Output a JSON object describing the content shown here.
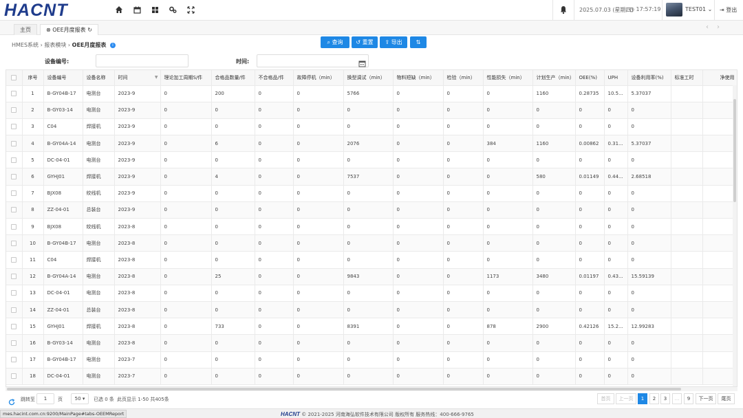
{
  "header": {
    "logo": "HACNT",
    "date": "2025.07.03 (星期四)",
    "time": "17:57:19",
    "user": "TEST01",
    "logout": "登出"
  },
  "tabs": [
    {
      "label": "主页"
    },
    {
      "label": "OEE月度报表"
    }
  ],
  "breadcrumb": {
    "root": "HMES系统",
    "module": "报表模块",
    "current": "OEE月度报表"
  },
  "toolbar": {
    "query": "查询",
    "reset": "重置",
    "export": "导出"
  },
  "filters": {
    "device_label": "设备编号:",
    "device_value": "",
    "time_label": "时间:",
    "time_value": ""
  },
  "table": {
    "columns": [
      "序号",
      "设备编号",
      "设备名称",
      "时间",
      "理论加工周期S/件",
      "合格品数量/件",
      "不合格品/件",
      "故障停机（min）",
      "换型调试（min）",
      "物料短缺（min）",
      "检验（min）",
      "性能损失（min）",
      "计划生产（min）",
      "OEE(%)",
      "UPH",
      "设备利用率(%)",
      "标准工时",
      "净使用"
    ],
    "rows": [
      [
        "1",
        "B-GY04B-17",
        "电测台",
        "2023-9",
        "0",
        "200",
        "0",
        "0",
        "5766",
        "0",
        "0",
        "0",
        "1160",
        "0.28735",
        "10.5...",
        "5.37037",
        "",
        ""
      ],
      [
        "2",
        "B-GY03-14",
        "电测台",
        "2023-9",
        "0",
        "0",
        "0",
        "0",
        "0",
        "0",
        "0",
        "0",
        "0",
        "0",
        "0",
        "0",
        "",
        ""
      ],
      [
        "3",
        "C04",
        "焊接机",
        "2023-9",
        "0",
        "0",
        "0",
        "0",
        "0",
        "0",
        "0",
        "0",
        "0",
        "0",
        "0",
        "0",
        "",
        ""
      ],
      [
        "4",
        "B-GY04A-14",
        "电测台",
        "2023-9",
        "0",
        "6",
        "0",
        "0",
        "2076",
        "0",
        "0",
        "384",
        "1160",
        "0.00862",
        "0.31...",
        "5.37037",
        "",
        ""
      ],
      [
        "5",
        "DC-04-01",
        "电测台",
        "2023-9",
        "0",
        "0",
        "0",
        "0",
        "0",
        "0",
        "0",
        "0",
        "0",
        "0",
        "0",
        "0",
        "",
        ""
      ],
      [
        "6",
        "GYHJ01",
        "焊接机",
        "2023-9",
        "0",
        "4",
        "0",
        "0",
        "7537",
        "0",
        "0",
        "0",
        "580",
        "0.01149",
        "0.44...",
        "2.68518",
        "",
        ""
      ],
      [
        "7",
        "BJX08",
        "绞线机",
        "2023-9",
        "0",
        "0",
        "0",
        "0",
        "0",
        "0",
        "0",
        "0",
        "0",
        "0",
        "0",
        "0",
        "",
        ""
      ],
      [
        "8",
        "ZZ-04-01",
        "总装台",
        "2023-9",
        "0",
        "0",
        "0",
        "0",
        "0",
        "0",
        "0",
        "0",
        "0",
        "0",
        "0",
        "0",
        "",
        ""
      ],
      [
        "9",
        "BJX08",
        "绞线机",
        "2023-8",
        "0",
        "0",
        "0",
        "0",
        "0",
        "0",
        "0",
        "0",
        "0",
        "0",
        "0",
        "0",
        "",
        ""
      ],
      [
        "10",
        "B-GY04B-17",
        "电测台",
        "2023-8",
        "0",
        "0",
        "0",
        "0",
        "0",
        "0",
        "0",
        "0",
        "0",
        "0",
        "0",
        "0",
        "",
        ""
      ],
      [
        "11",
        "C04",
        "焊接机",
        "2023-8",
        "0",
        "0",
        "0",
        "0",
        "0",
        "0",
        "0",
        "0",
        "0",
        "0",
        "0",
        "0",
        "",
        ""
      ],
      [
        "12",
        "B-GY04A-14",
        "电测台",
        "2023-8",
        "0",
        "25",
        "0",
        "0",
        "9843",
        "0",
        "0",
        "1173",
        "3480",
        "0.01197",
        "0.43...",
        "15.59139",
        "",
        ""
      ],
      [
        "13",
        "DC-04-01",
        "电测台",
        "2023-8",
        "0",
        "0",
        "0",
        "0",
        "0",
        "0",
        "0",
        "0",
        "0",
        "0",
        "0",
        "0",
        "",
        ""
      ],
      [
        "14",
        "ZZ-04-01",
        "总装台",
        "2023-8",
        "0",
        "0",
        "0",
        "0",
        "0",
        "0",
        "0",
        "0",
        "0",
        "0",
        "0",
        "0",
        "",
        ""
      ],
      [
        "15",
        "GYHJ01",
        "焊接机",
        "2023-8",
        "0",
        "733",
        "0",
        "0",
        "8391",
        "0",
        "0",
        "878",
        "2900",
        "0.42126",
        "15.2...",
        "12.99283",
        "",
        ""
      ],
      [
        "16",
        "B-GY03-14",
        "电测台",
        "2023-8",
        "0",
        "0",
        "0",
        "0",
        "0",
        "0",
        "0",
        "0",
        "0",
        "0",
        "0",
        "0",
        "",
        ""
      ],
      [
        "17",
        "B-GY04B-17",
        "电测台",
        "2023-7",
        "0",
        "0",
        "0",
        "0",
        "0",
        "0",
        "0",
        "0",
        "0",
        "0",
        "0",
        "0",
        "",
        ""
      ],
      [
        "18",
        "DC-04-01",
        "电测台",
        "2023-7",
        "0",
        "0",
        "0",
        "0",
        "0",
        "0",
        "0",
        "0",
        "0",
        "0",
        "0",
        "0",
        "",
        ""
      ]
    ]
  },
  "pager": {
    "goto_label": "跳转至",
    "goto_value": "1",
    "page_unit": "页",
    "page_size": "50",
    "selected": "已选 0 条",
    "summary": "此页显示 1-50 共405条",
    "first": "首页",
    "prev": "上一页",
    "pages": [
      "1",
      "2",
      "3",
      "...",
      "9"
    ],
    "next": "下一页",
    "last": "尾页"
  },
  "footer": {
    "url": "mes.hacint.com.cn:9200/MainPage#tabs-OEEMReport",
    "brand": "HACNT",
    "copyright": "© 2021-2025 河南海弘软件技术有限公司 版权所有 服务热线：400-666-9765"
  },
  "colors": {
    "accent": "#1e88e5",
    "brand": "#1f3c8c"
  }
}
